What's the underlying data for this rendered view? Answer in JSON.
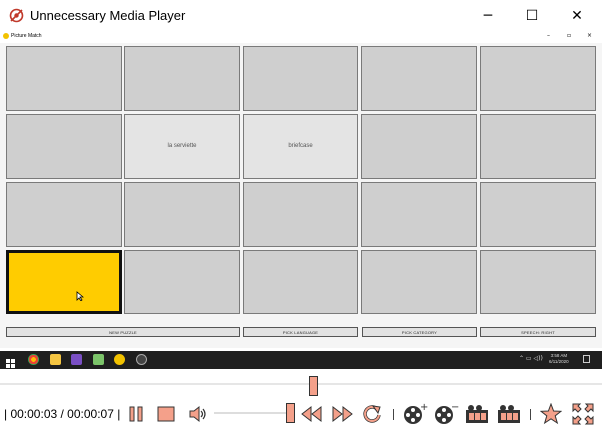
{
  "app": {
    "title": "Unnecessary Media Player"
  },
  "window_controls": {
    "minimize": "─",
    "maximize": "☐",
    "close": "✕"
  },
  "inner_window": {
    "title": "Picture Match",
    "minimize": "–",
    "restore": "▫",
    "close": "×"
  },
  "board": {
    "tiles": [
      {
        "label": ""
      },
      {
        "label": ""
      },
      {
        "label": ""
      },
      {
        "label": ""
      },
      {
        "label": ""
      },
      {
        "label": ""
      },
      {
        "label": "la serviette"
      },
      {
        "label": "briefcase"
      },
      {
        "label": ""
      },
      {
        "label": ""
      },
      {
        "label": ""
      },
      {
        "label": ""
      },
      {
        "label": ""
      },
      {
        "label": ""
      },
      {
        "label": ""
      },
      {
        "label": ""
      },
      {
        "label": ""
      },
      {
        "label": ""
      },
      {
        "label": ""
      },
      {
        "label": ""
      }
    ],
    "selected_tile_color": "#ffcc00"
  },
  "game_buttons": {
    "new_puzzle": "NEW PUZZLE",
    "pick_language": "PICK LANGUAGE",
    "pick_category": "PICK CATEGORY",
    "speech_right": "SPEECH: RIGHT"
  },
  "taskbar": {
    "time": "3:58 AM",
    "date": "6/11/2020"
  },
  "player": {
    "time_display": "| 00:00:03 / 00:00:07 |",
    "accent_color": "#f4a08a"
  }
}
